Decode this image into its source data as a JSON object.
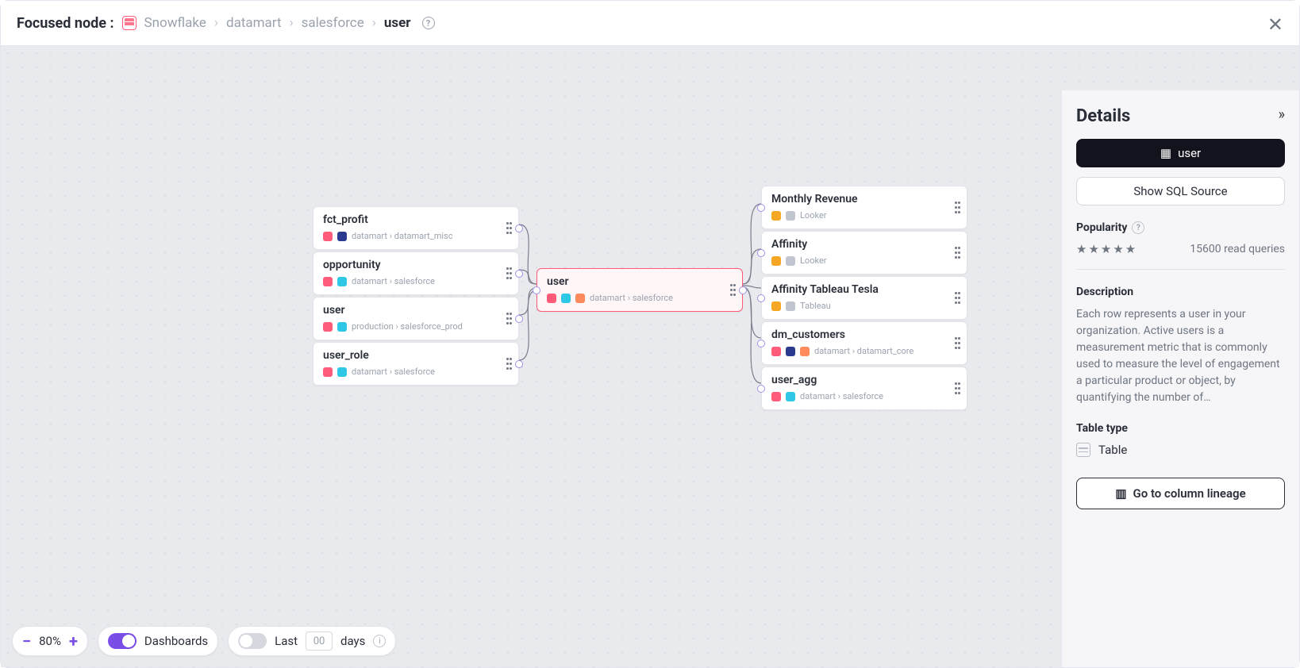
{
  "header": {
    "label": "Focused node :",
    "breadcrumb": [
      "Snowflake",
      "datamart",
      "salesforce",
      "user"
    ]
  },
  "canvas": {
    "upstream": [
      {
        "title": "fct_profit",
        "path": "datamart › datamart_misc",
        "icons": [
          "red",
          "navy"
        ]
      },
      {
        "title": "opportunity",
        "path": "datamart › salesforce",
        "icons": [
          "red",
          "cyan"
        ]
      },
      {
        "title": "user",
        "path": "production › salesforce_prod",
        "icons": [
          "red",
          "cyan"
        ]
      },
      {
        "title": "user_role",
        "path": "datamart › salesforce",
        "icons": [
          "red",
          "cyan"
        ]
      }
    ],
    "focused": {
      "title": "user",
      "path": "datamart › salesforce",
      "icons": [
        "red",
        "cyan",
        "peach"
      ]
    },
    "downstream": [
      {
        "title": "Monthly Revenue",
        "path": "Looker",
        "icons": [
          "orange",
          "grey"
        ]
      },
      {
        "title": "Affinity",
        "path": "Looker",
        "icons": [
          "orange",
          "grey"
        ]
      },
      {
        "title": "Affinity Tableau Tesla",
        "path": "Tableau",
        "icons": [
          "orange",
          "grey"
        ]
      },
      {
        "title": "dm_customers",
        "path": "datamart › datamart_core",
        "icons": [
          "red",
          "navy",
          "peach"
        ]
      },
      {
        "title": "user_agg",
        "path": "datamart › salesforce",
        "icons": [
          "red",
          "cyan"
        ]
      }
    ]
  },
  "controls": {
    "zoom": "80%",
    "dashboards_label": "Dashboards",
    "dashboards_on": true,
    "last_label": "Last",
    "days_value": "00",
    "days_label": "days",
    "last_on": false
  },
  "details": {
    "title": "Details",
    "chip_label": "user",
    "show_sql_label": "Show SQL Source",
    "popularity_label": "Popularity",
    "popularity_readout": "15600 read queries",
    "description_label": "Description",
    "description_text": "Each row represents a user in your organization. Active users is a measurement metric that is commonly used to measure the level of engagement a particular product or object, by quantifying the number of…",
    "table_type_label": "Table type",
    "table_type_value": "Table",
    "lineage_button": "Go to column lineage"
  }
}
